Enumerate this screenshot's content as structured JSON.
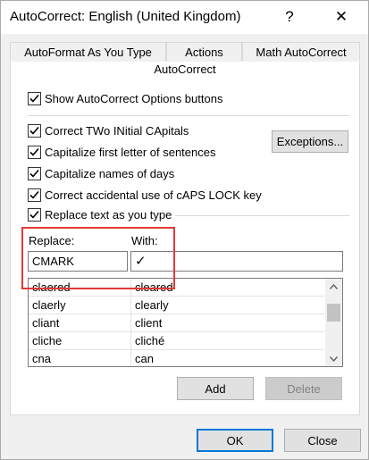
{
  "window": {
    "title": "AutoCorrect: English (United Kingdom)",
    "help_glyph": "?",
    "close_glyph": "✕"
  },
  "tabs": [
    {
      "label": "AutoFormat As You Type"
    },
    {
      "label": "Actions"
    },
    {
      "label": "Math AutoCorrect"
    }
  ],
  "active_tab": {
    "label": "AutoCorrect"
  },
  "options": {
    "show_buttons": {
      "label": "Show AutoCorrect Options buttons",
      "checked": true
    },
    "two_initial_caps": {
      "label": "Correct TWo INitial CApitals",
      "checked": true
    },
    "capitalize_sentences": {
      "label": "Capitalize first letter of sentences",
      "checked": true
    },
    "capitalize_days": {
      "label": "Capitalize names of days",
      "checked": true
    },
    "caps_lock": {
      "label": "Correct accidental use of cAPS LOCK key",
      "checked": true
    },
    "replace_text": {
      "label": "Replace text as you type",
      "checked": true
    }
  },
  "exceptions_button": "Exceptions...",
  "replace": {
    "label": "Replace:",
    "value": "CMARK"
  },
  "with": {
    "label": "With:",
    "value": "✓"
  },
  "entries": [
    {
      "replace": "claered",
      "with": "cleared"
    },
    {
      "replace": "claerly",
      "with": "clearly"
    },
    {
      "replace": "cliant",
      "with": "client"
    },
    {
      "replace": "cliche",
      "with": "cliché"
    },
    {
      "replace": "cna",
      "with": "can"
    }
  ],
  "add_button": "Add",
  "delete_button": "Delete",
  "ok_button": "OK",
  "close_button": "Close",
  "highlight_color": "#e53935"
}
